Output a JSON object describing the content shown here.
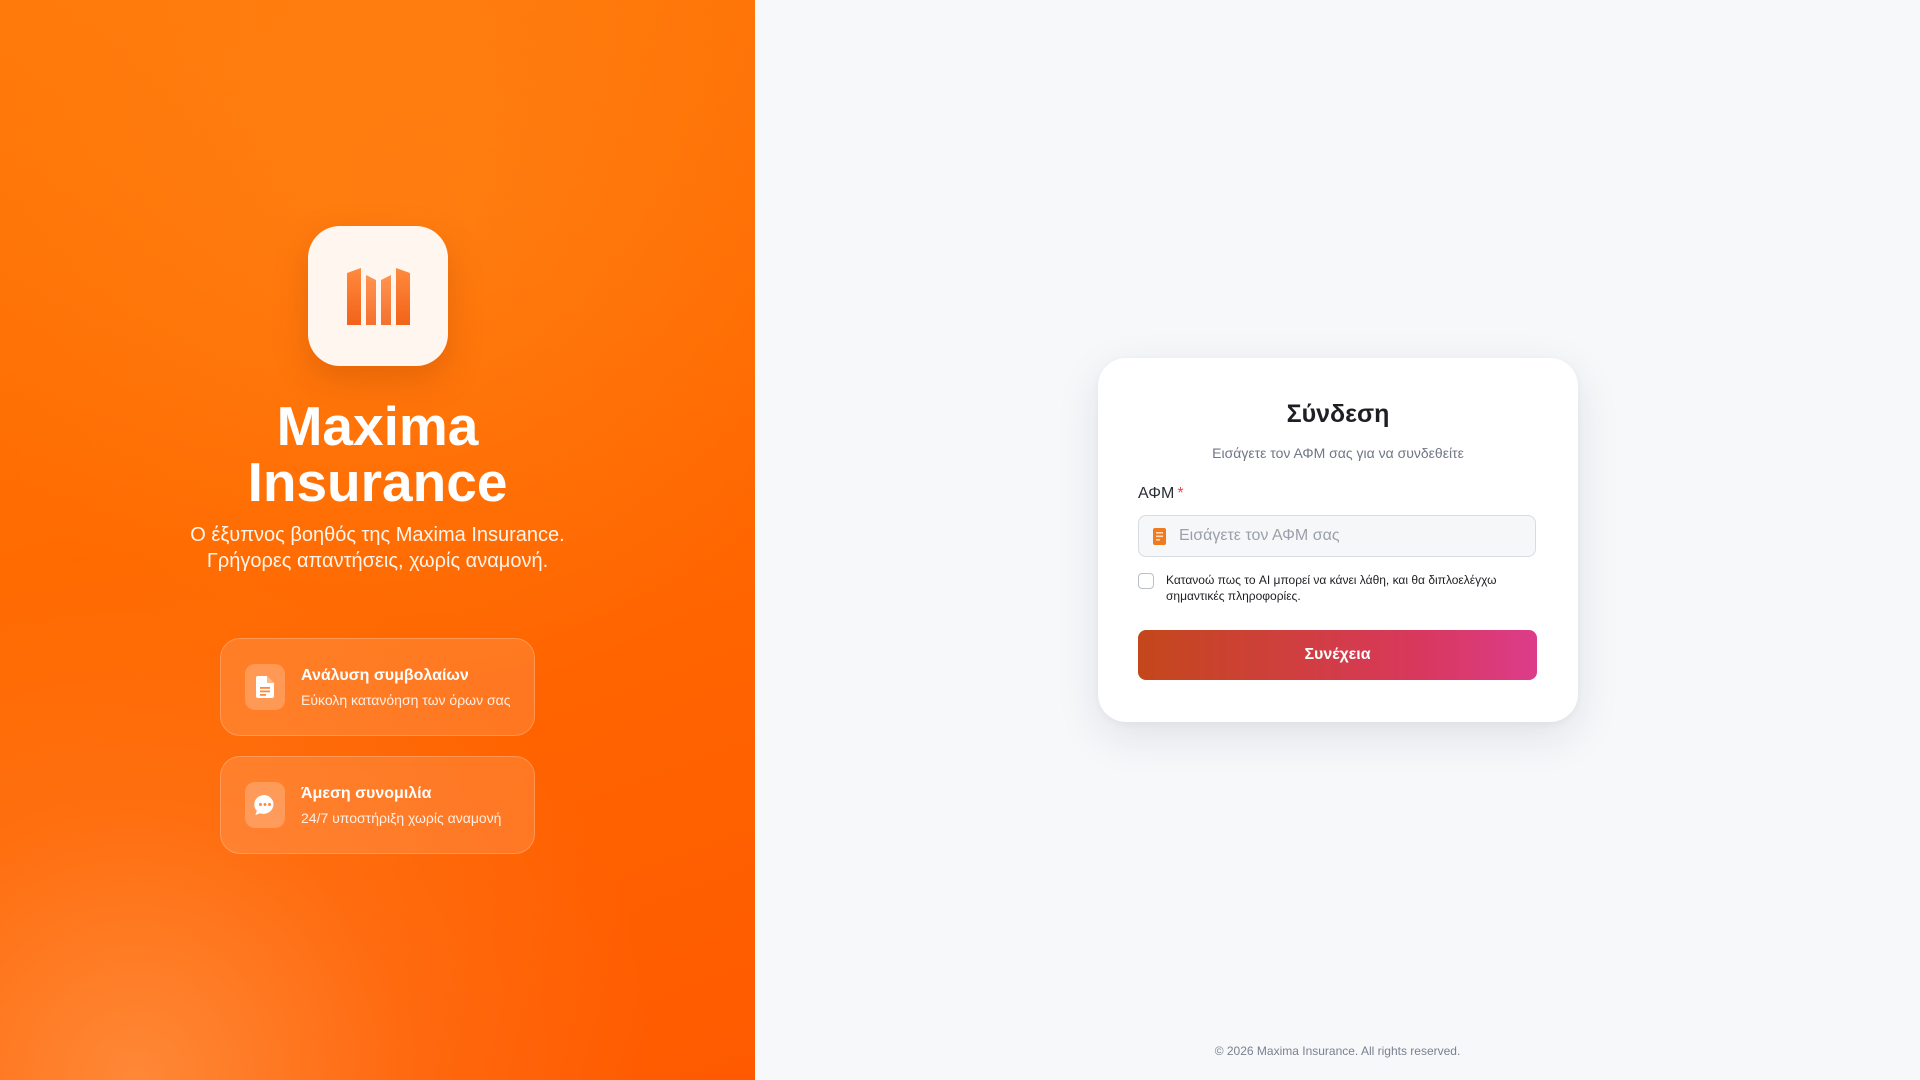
{
  "brand": {
    "title_line1": "Maxima",
    "title_line2": "Insurance",
    "tagline_line1": "Ο έξυπνος βοηθός της Maxima Insurance.",
    "tagline_line2": "Γρήγορες απαντήσεις, χωρίς αναμονή.",
    "logo_icon": "maxima-m-logo-icon",
    "accent_color": "#ff6a00"
  },
  "features": [
    {
      "icon": "document-icon",
      "title": "Ανάλυση συμβολαίων",
      "subtitle": "Εύκολη κατανόηση των όρων σας"
    },
    {
      "icon": "chat-bubble-icon",
      "title": "Άμεση συνομιλία",
      "subtitle": "24/7 υποστήριξη χωρίς αναμονή"
    }
  ],
  "login": {
    "title": "Σύνδεση",
    "subtitle": "Εισάγετε τον ΑΦΜ σας για να συνδεθείτε",
    "field_label": "ΑΦΜ",
    "required_mark": "*",
    "field_placeholder": "Εισάγετε τον ΑΦΜ σας",
    "field_value": "",
    "field_icon": "id-card-icon",
    "consent_text": "Κατανοώ πως το AI μπορεί να κάνει λάθη, και θα διπλοελέγχω σημαντικές πληροφορίες.",
    "consent_checked": false,
    "continue_label": "Συνέχεια",
    "button_gradient": [
      "#c4471b",
      "#dc3c8a"
    ]
  },
  "footer": {
    "copyright": "© 2026 Maxima Insurance. All rights reserved."
  }
}
